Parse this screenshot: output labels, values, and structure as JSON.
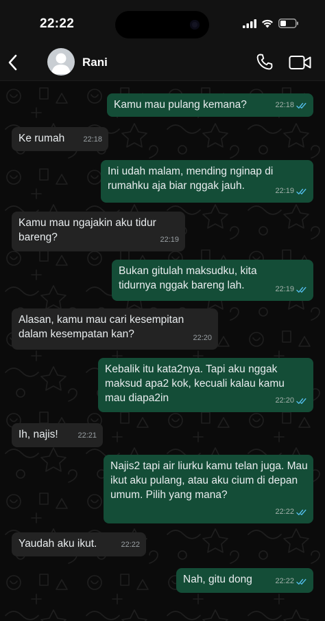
{
  "status": {
    "time": "22:22"
  },
  "header": {
    "contact_name": "Rani"
  },
  "colors": {
    "outgoing_bubble": "#144d37",
    "incoming_bubble": "#232323",
    "read_ticks": "#53bdeb",
    "background": "#0b0b0b"
  },
  "messages": [
    {
      "direction": "out",
      "text": "Kamu mau pulang kemana?",
      "time": "22:18",
      "status": "read"
    },
    {
      "direction": "in",
      "text": "Ke rumah",
      "time": "22:18"
    },
    {
      "direction": "out",
      "text": "Ini udah malam, mending nginap di rumahku aja biar nggak jauh.",
      "time": "22:19",
      "status": "read"
    },
    {
      "direction": "in",
      "text": "Kamu mau ngajakin aku tidur bareng?",
      "time": "22:19"
    },
    {
      "direction": "out",
      "text": "Bukan gitulah maksudku, kita tidurnya nggak bareng lah.",
      "time": "22:19",
      "status": "read"
    },
    {
      "direction": "in",
      "text": "Alasan, kamu mau cari kesempitan dalam kesempatan kan?",
      "time": "22:20"
    },
    {
      "direction": "out",
      "text": "Kebalik itu kata2nya. Tapi aku nggak maksud apa2 kok, kecuali kalau kamu mau diapa2in",
      "time": "22:20",
      "status": "read"
    },
    {
      "direction": "in",
      "text": "Ih, najis!",
      "time": "22:21"
    },
    {
      "direction": "out",
      "text": "Najis2 tapi air liurku kamu telan juga. Mau ikut aku pulang, atau aku cium di depan umum. Pilih yang mana?",
      "time": "22:22",
      "status": "read"
    },
    {
      "direction": "in",
      "text": "Yaudah aku ikut.",
      "time": "22:22"
    },
    {
      "direction": "out",
      "text": "Nah, gitu dong",
      "time": "22:22",
      "status": "read"
    }
  ]
}
